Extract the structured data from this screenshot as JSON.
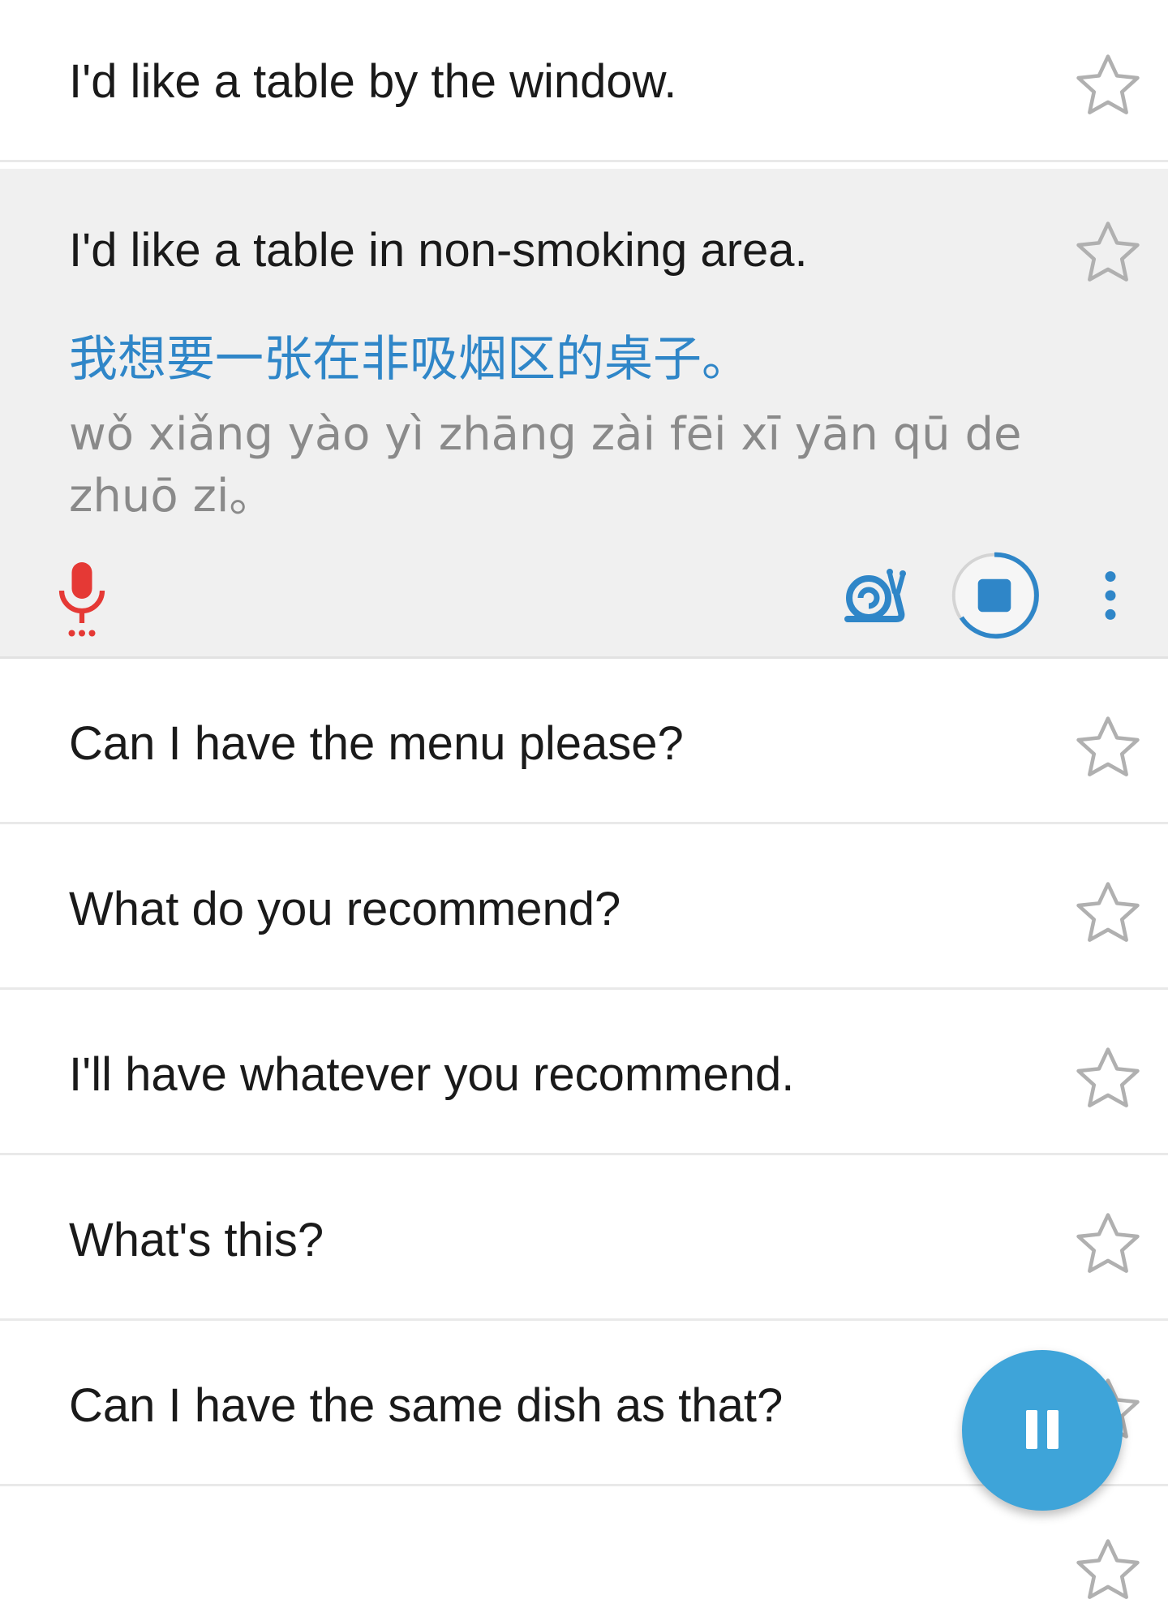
{
  "phrases": [
    {
      "en": "I'd like a table by the window.",
      "starred": false
    },
    {
      "en": "I'd like a table in non-smoking area.",
      "zh": "我想要一张在非吸烟区的桌子。",
      "pinyin": "wǒ xiǎng yào yì zhāng zài fēi xī yān qū de zhuō zi。",
      "starred": false,
      "expanded": true
    },
    {
      "en": "Can I have the menu please?",
      "starred": false
    },
    {
      "en": "What do you recommend?",
      "starred": false
    },
    {
      "en": "I'll have whatever you recommend.",
      "starred": false
    },
    {
      "en": "What's this?",
      "starred": false
    },
    {
      "en": "Can I have the same dish as that?",
      "starred": false
    },
    {
      "en": "",
      "starred": false
    }
  ],
  "icons": {
    "star": "star-outline-icon",
    "mic": "microphone-icon",
    "slow": "snail-icon",
    "stop": "stop-icon",
    "more": "more-vertical-icon",
    "pause": "pause-icon"
  },
  "colors": {
    "accent": "#2f86c8",
    "fab": "#3ea4d9",
    "mic": "#e53935",
    "expanded_bg": "#f0f0f0",
    "pinyin": "#8a8a8a"
  }
}
